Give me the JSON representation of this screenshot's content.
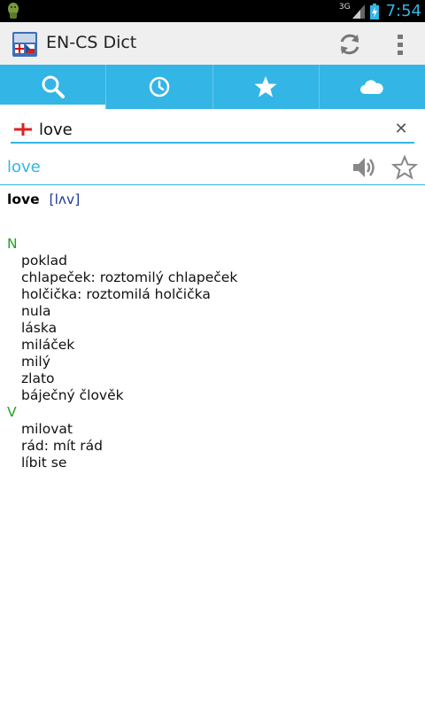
{
  "status_bar": {
    "network": "3G",
    "time": "7:54",
    "accent": "#33b5e5"
  },
  "action_bar": {
    "title": "EN-CS Dict",
    "app_icon": "dictionary-app-icon",
    "actions": [
      "refresh-icon",
      "overflow-menu-icon"
    ]
  },
  "tabs": [
    {
      "icon": "search-icon",
      "active": true
    },
    {
      "icon": "history-clock-icon",
      "active": false
    },
    {
      "icon": "favorites-star-icon",
      "active": false
    },
    {
      "icon": "cloud-icon",
      "active": false
    }
  ],
  "search": {
    "value": "love",
    "flag": "english-flag-icon"
  },
  "result": {
    "word": "love"
  },
  "entry": {
    "headword": "love",
    "pronunciation": "[lʌv]",
    "groups": [
      {
        "pos": "N",
        "senses": [
          "poklad",
          "chlapeček: roztomilý chlapeček",
          "holčička: roztomilá holčička",
          "nula",
          "láska",
          "miláček",
          "milý",
          "zlato",
          "báječný člověk"
        ]
      },
      {
        "pos": "V",
        "senses": [
          "milovat",
          "rád: mít rád",
          "líbit se"
        ]
      }
    ]
  }
}
